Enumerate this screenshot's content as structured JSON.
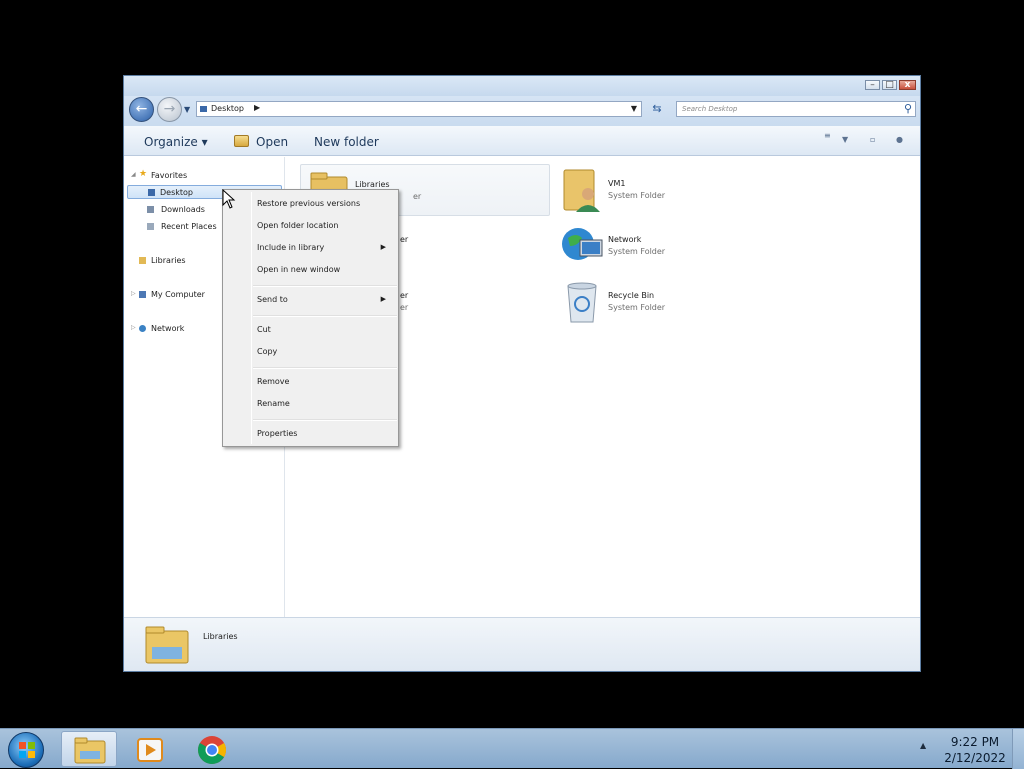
{
  "window": {
    "address": "Desktop",
    "search_placeholder": "Search Desktop"
  },
  "toolbar": {
    "organize": "Organize ▾",
    "open": "Open",
    "new_folder": "New folder"
  },
  "nav": {
    "favorites": "Favorites",
    "desktop": "Desktop",
    "downloads": "Downloads",
    "recent_places": "Recent Places",
    "libraries": "Libraries",
    "my_computer": "My Computer",
    "network": "Network"
  },
  "content": {
    "items": [
      {
        "name": "Libraries",
        "type": "System Folder",
        "icon": "libraries-icon"
      },
      {
        "name": "VM1",
        "type": "System Folder",
        "icon": "user-folder-icon"
      },
      {
        "name": "Network",
        "type": "System Folder",
        "icon": "network-icon"
      },
      {
        "name": "Recycle Bin",
        "type": "System Folder",
        "icon": "recycle-bin-icon"
      }
    ],
    "partial_labels": [
      "er",
      "er",
      "er",
      "er"
    ]
  },
  "context_menu": {
    "items": [
      "Restore previous versions",
      "Open folder location",
      "Include in library",
      "Open in new window",
      "Send to",
      "Cut",
      "Copy",
      "Remove",
      "Rename",
      "Properties"
    ]
  },
  "details": {
    "name": "Libraries"
  },
  "taskbar": {
    "time": "9:22 PM",
    "date": "2/12/2022"
  }
}
